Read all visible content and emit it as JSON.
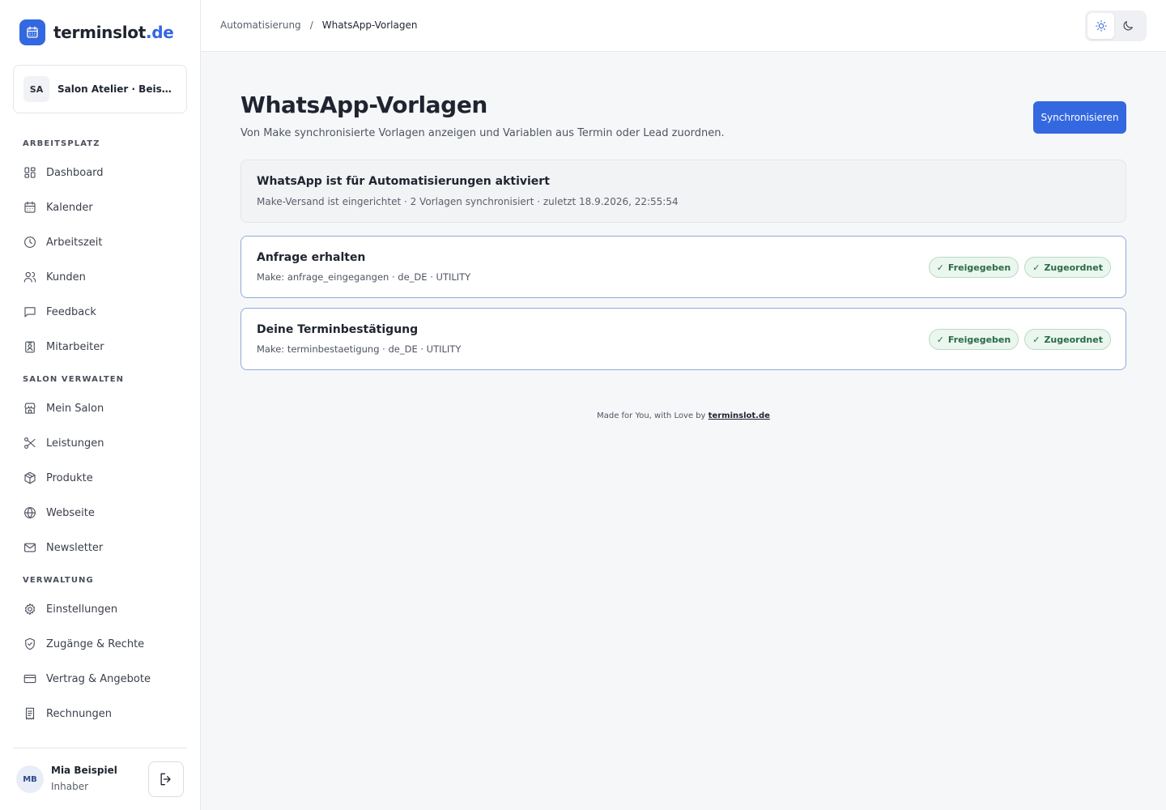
{
  "brand": {
    "name": "terminslot",
    "tld": ".de",
    "accent": "#3468e0"
  },
  "salon": {
    "initials": "SA",
    "name": "Salon Atelier · Beispiel…"
  },
  "sidebar": {
    "sections": [
      {
        "label": "ARBEITSPLATZ",
        "items": [
          {
            "label": "Dashboard",
            "icon": "dashboard-icon"
          },
          {
            "label": "Kalender",
            "icon": "calendar-icon"
          },
          {
            "label": "Arbeitszeit",
            "icon": "clock-icon"
          },
          {
            "label": "Kunden",
            "icon": "users-icon"
          },
          {
            "label": "Feedback",
            "icon": "message-icon"
          },
          {
            "label": "Mitarbeiter",
            "icon": "badge-icon"
          }
        ]
      },
      {
        "label": "SALON VERWALTEN",
        "items": [
          {
            "label": "Mein Salon",
            "icon": "store-icon"
          },
          {
            "label": "Leistungen",
            "icon": "scissors-icon"
          },
          {
            "label": "Produkte",
            "icon": "package-icon"
          },
          {
            "label": "Webseite",
            "icon": "globe-icon"
          },
          {
            "label": "Newsletter",
            "icon": "mail-icon"
          }
        ]
      },
      {
        "label": "VERWALTUNG",
        "items": [
          {
            "label": "Einstellungen",
            "icon": "gear-icon"
          },
          {
            "label": "Zugänge & Rechte",
            "icon": "shield-icon"
          },
          {
            "label": "Vertrag & Angebote",
            "icon": "credit-card-icon"
          },
          {
            "label": "Rechnungen",
            "icon": "receipt-icon"
          }
        ]
      }
    ]
  },
  "user": {
    "initials": "MB",
    "name": "Mia Beispiel",
    "role": "Inhaber"
  },
  "breadcrumb": {
    "parent": "Automatisierung",
    "separator": "/",
    "current": "WhatsApp-Vorlagen"
  },
  "page": {
    "title": "WhatsApp-Vorlagen",
    "subtitle": "Von Make synchronisierte Vorlagen anzeigen und Variablen aus Termin oder Lead zuordnen.",
    "sync_label": "Synchronisieren"
  },
  "status": {
    "title": "WhatsApp ist für Automatisierungen aktiviert",
    "meta": "Make-Versand ist eingerichtet · 2 Vorlagen synchronisiert · zuletzt 18.9.2026, 22:55:54"
  },
  "templates": [
    {
      "name": "Anfrage erhalten",
      "meta": "Make: anfrage_eingegangen · de_DE · UTILITY",
      "badges": [
        "Freigegeben",
        "Zugeordnet"
      ]
    },
    {
      "name": "Deine Terminbestätigung",
      "meta": "Make: terminbestaetigung · de_DE · UTILITY",
      "badges": [
        "Freigegeben",
        "Zugeordnet"
      ]
    }
  ],
  "badge_check": "✓",
  "footer": {
    "text": "Made for You, with Love by",
    "link": "terminslot.de"
  }
}
